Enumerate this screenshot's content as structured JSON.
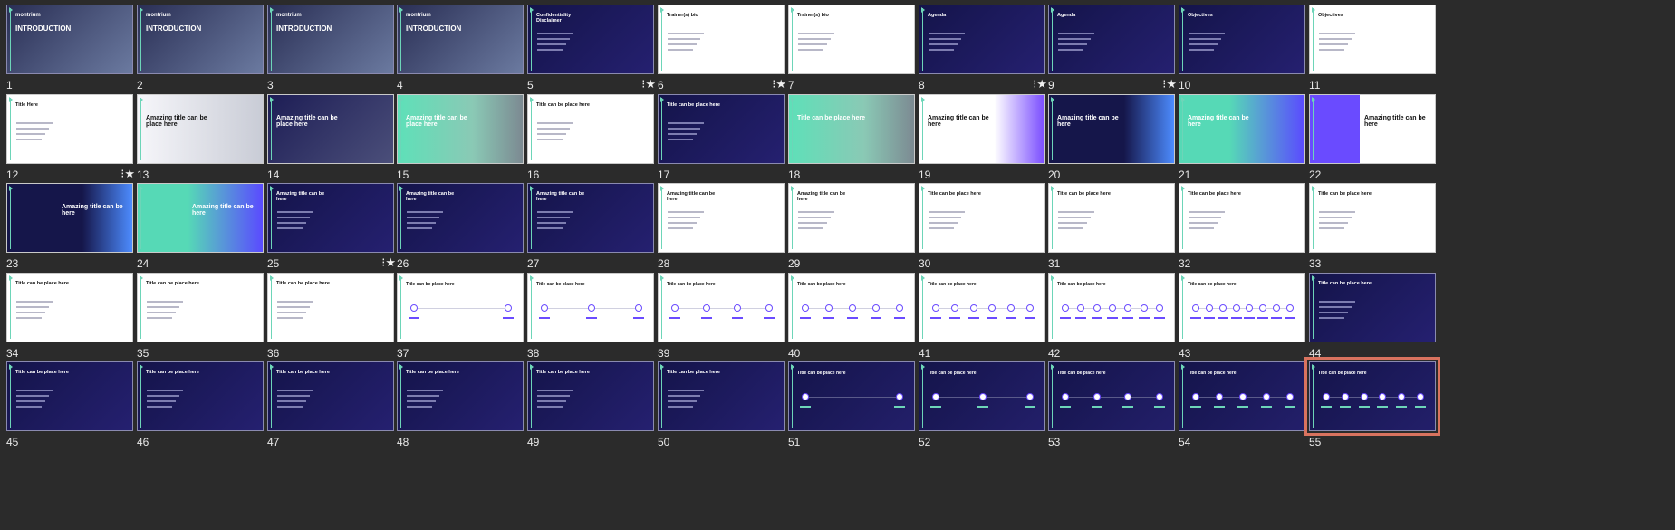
{
  "colors": {
    "background": "#2b2b2b",
    "dark": "#1a1a4a",
    "mint": "#6dd5b8",
    "purple": "#6a4bff",
    "selection": "#d9735f"
  },
  "slides": [
    {
      "n": "1",
      "kind": "intro",
      "title": "INTRODUCTION",
      "logo": "montrium"
    },
    {
      "n": "2",
      "kind": "intro",
      "title": "INTRODUCTION",
      "logo": "montrium"
    },
    {
      "n": "3",
      "kind": "intro",
      "title": "INTRODUCTION",
      "logo": "montrium"
    },
    {
      "n": "4",
      "kind": "intro",
      "title": "INTRODUCTION",
      "logo": "montrium"
    },
    {
      "n": "5",
      "kind": "dark",
      "title": "Confidentiality Disclaimer",
      "star": true
    },
    {
      "n": "6",
      "kind": "white",
      "title": "Trainer(s) bio",
      "star": true
    },
    {
      "n": "7",
      "kind": "white",
      "title": "Trainer(s) bio"
    },
    {
      "n": "8",
      "kind": "dark",
      "title": "Agenda",
      "star": true
    },
    {
      "n": "9",
      "kind": "dark",
      "title": "Agenda",
      "star": true
    },
    {
      "n": "10",
      "kind": "dark",
      "title": "Objectives"
    },
    {
      "n": "11",
      "kind": "white",
      "title": "Objectives"
    },
    {
      "n": "12",
      "kind": "white",
      "title": "Title Here",
      "star": true
    },
    {
      "n": "13",
      "kind": "photo-light",
      "title": "Amazing title can be place here"
    },
    {
      "n": "14",
      "kind": "photo-dark",
      "title": "Amazing title can be place here"
    },
    {
      "n": "15",
      "kind": "mint",
      "title": "Amazing title can be place here"
    },
    {
      "n": "16",
      "kind": "white",
      "title": "Title can be place here"
    },
    {
      "n": "17",
      "kind": "dark",
      "title": "Title can be place here"
    },
    {
      "n": "18",
      "kind": "mint",
      "title": "Title can be place here"
    },
    {
      "n": "19",
      "kind": "split-white",
      "title": "Amazing title can be here"
    },
    {
      "n": "20",
      "kind": "split-dark",
      "title": "Amazing title can be here"
    },
    {
      "n": "21",
      "kind": "split-mint",
      "title": "Amazing title can be here"
    },
    {
      "n": "22",
      "kind": "split-white2",
      "title": "Amazing title can be here"
    },
    {
      "n": "23",
      "kind": "split-dark",
      "title": "Amazing title can be here"
    },
    {
      "n": "24",
      "kind": "split-mint",
      "title": "Amazing title can be here"
    },
    {
      "n": "25",
      "kind": "dark",
      "title": "Amazing title can be here",
      "star": true
    },
    {
      "n": "26",
      "kind": "dark",
      "title": "Amazing title can be here"
    },
    {
      "n": "27",
      "kind": "dark",
      "title": "Amazing title can be here"
    },
    {
      "n": "28",
      "kind": "white",
      "title": "Amazing title can be here"
    },
    {
      "n": "29",
      "kind": "white",
      "title": "Amazing title can be here"
    },
    {
      "n": "30",
      "kind": "white",
      "title": "Title can be place here"
    },
    {
      "n": "31",
      "kind": "white",
      "title": "Title can be place here"
    },
    {
      "n": "32",
      "kind": "white",
      "title": "Title can be place here"
    },
    {
      "n": "33",
      "kind": "white",
      "title": "Title can be place here"
    },
    {
      "n": "34",
      "kind": "white",
      "title": "Title can be place here"
    },
    {
      "n": "35",
      "kind": "white",
      "title": "Title can be place here"
    },
    {
      "n": "36",
      "kind": "white",
      "title": "Title can be place here"
    },
    {
      "n": "37",
      "kind": "timeline-white",
      "title": "Title can be place here",
      "nodes": 2
    },
    {
      "n": "38",
      "kind": "timeline-white",
      "title": "Title can be place here",
      "nodes": 3
    },
    {
      "n": "39",
      "kind": "timeline-white",
      "title": "Title can be place here",
      "nodes": 4
    },
    {
      "n": "40",
      "kind": "timeline-white",
      "title": "Title can be place here",
      "nodes": 5
    },
    {
      "n": "41",
      "kind": "timeline-white",
      "title": "Title can be place here",
      "nodes": 6
    },
    {
      "n": "42",
      "kind": "timeline-white",
      "title": "Title can be place here",
      "nodes": 7
    },
    {
      "n": "43",
      "kind": "timeline-white",
      "title": "Title can be place here",
      "nodes": 8
    },
    {
      "n": "44",
      "kind": "dark",
      "title": "Title can be place here"
    },
    {
      "n": "45",
      "kind": "dark",
      "title": "Title can be place here"
    },
    {
      "n": "46",
      "kind": "dark",
      "title": "Title can be place here"
    },
    {
      "n": "47",
      "kind": "dark",
      "title": "Title can be place here"
    },
    {
      "n": "48",
      "kind": "dark",
      "title": "Title can be place here"
    },
    {
      "n": "49",
      "kind": "dark",
      "title": "Title can be place here"
    },
    {
      "n": "50",
      "kind": "dark",
      "title": "Title can be place here"
    },
    {
      "n": "51",
      "kind": "timeline-dark",
      "title": "Title can be place here",
      "nodes": 2
    },
    {
      "n": "52",
      "kind": "timeline-dark",
      "title": "Title can be place here",
      "nodes": 3
    },
    {
      "n": "53",
      "kind": "timeline-dark",
      "title": "Title can be place here",
      "nodes": 4
    },
    {
      "n": "54",
      "kind": "timeline-dark",
      "title": "Title can be place here",
      "nodes": 5
    },
    {
      "n": "55",
      "kind": "timeline-dark",
      "title": "Title can be place here",
      "nodes": 6,
      "selected": true
    }
  ]
}
